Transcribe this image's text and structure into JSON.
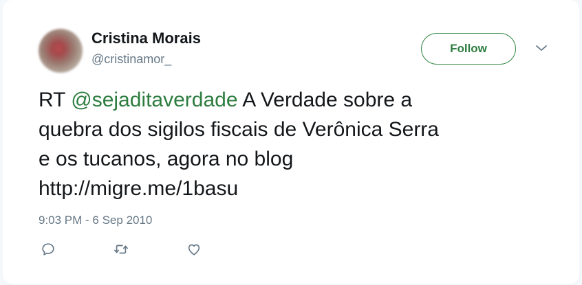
{
  "author": {
    "name": "Cristina Morais",
    "handle": "@cristinamor_"
  },
  "follow_button": {
    "label": "Follow"
  },
  "tweet": {
    "line1_prefix": "RT ",
    "mention": "@sejaditaverdade",
    "line1_suffix": " A Verdade sobre a",
    "line2": "quebra dos sigilos fiscais de Verônica Serra",
    "line3": "e os tucanos, agora no blog",
    "line4": "http://migre.me/1basu"
  },
  "timestamp": "9:03 PM - 6 Sep 2010",
  "icons": {
    "more": "chevron-down-icon",
    "reply": "reply-icon",
    "retweet": "retweet-icon",
    "like": "heart-icon"
  },
  "colors": {
    "accent": "#2e7d40",
    "text": "#14171a",
    "secondary": "#657786"
  }
}
